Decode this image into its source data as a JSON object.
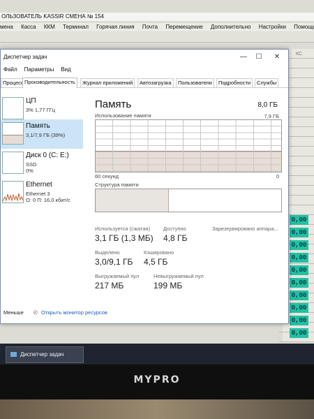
{
  "background_app": {
    "title": "ОЛЬЗОВАТЕЛЬ KASSIR СМЕНА № 154",
    "menu": [
      "мена",
      "Касса",
      "ККМ",
      "Терминал",
      "Горячая линия",
      "Почта",
      "Перемещение",
      "Дополнительно",
      "Настройки",
      "Помощь"
    ],
    "column_header": "КС",
    "cells": [
      "0,00",
      "0,00",
      "0,00",
      "0,00",
      "0,00",
      "0,00",
      "0,00",
      "0,00",
      "0,00",
      "0,00",
      "0,00"
    ]
  },
  "taskmgr": {
    "title": "Диспетчер задач",
    "win_controls": {
      "minimize": "—",
      "maximize": "☐",
      "close": "✕"
    },
    "menu": [
      "Файл",
      "Параметры",
      "Вид"
    ],
    "tabs": [
      "Процессы",
      "Производительность",
      "Журнал приложений",
      "Автозагрузка",
      "Пользователи",
      "Подробности",
      "Службы"
    ],
    "active_tab": 1,
    "sidebar": [
      {
        "name": "ЦП",
        "sub1": "3% 1,77 ГГц",
        "sub2": ""
      },
      {
        "name": "Память",
        "sub1": "3,1/7,9 ГБ (39%)",
        "sub2": ""
      },
      {
        "name": "Диск 0 (C: E:)",
        "sub1": "SSD",
        "sub2": "0%"
      },
      {
        "name": "Ethernet",
        "sub1": "Ethernet 3",
        "sub2": "О: 0 П: 16,0 кбит/с"
      }
    ],
    "memory": {
      "title": "Память",
      "total": "8,0 ГБ",
      "usage_label": "Использование памяти",
      "usage_max": "7,9 ГБ",
      "usage_fraction": 0.39,
      "axis_left": "60 секунд",
      "axis_right": "0",
      "structure_label": "Структура памяти",
      "stats": {
        "in_use_label": "Используется (сжатая)",
        "in_use_value": "3,1 ГБ (1,3 МБ)",
        "available_label": "Доступно",
        "available_value": "4,8 ГБ",
        "reserved_label": "Зарезервировано аппара...",
        "committed_label": "Выделено",
        "committed_value": "3,0/9,1 ГБ",
        "cached_label": "Кэшировано",
        "cached_value": "4,5 ГБ",
        "paged_label": "Выгружаемый пул",
        "paged_value": "217 МБ",
        "nonpaged_label": "Невыгружаемый пул",
        "nonpaged_value": "199 МБ"
      }
    },
    "footer": {
      "less": "Меньше",
      "monitor": "Открыть монитор ресурсов"
    }
  },
  "taskbar": {
    "item": "Диспетчер задач"
  },
  "monitor_brand": "MYPRO",
  "colors": {
    "selected": "#cce4f7",
    "memory_graph": "#e8ddd6",
    "link": "#1e5bb8",
    "cells": "#22c0a3"
  }
}
